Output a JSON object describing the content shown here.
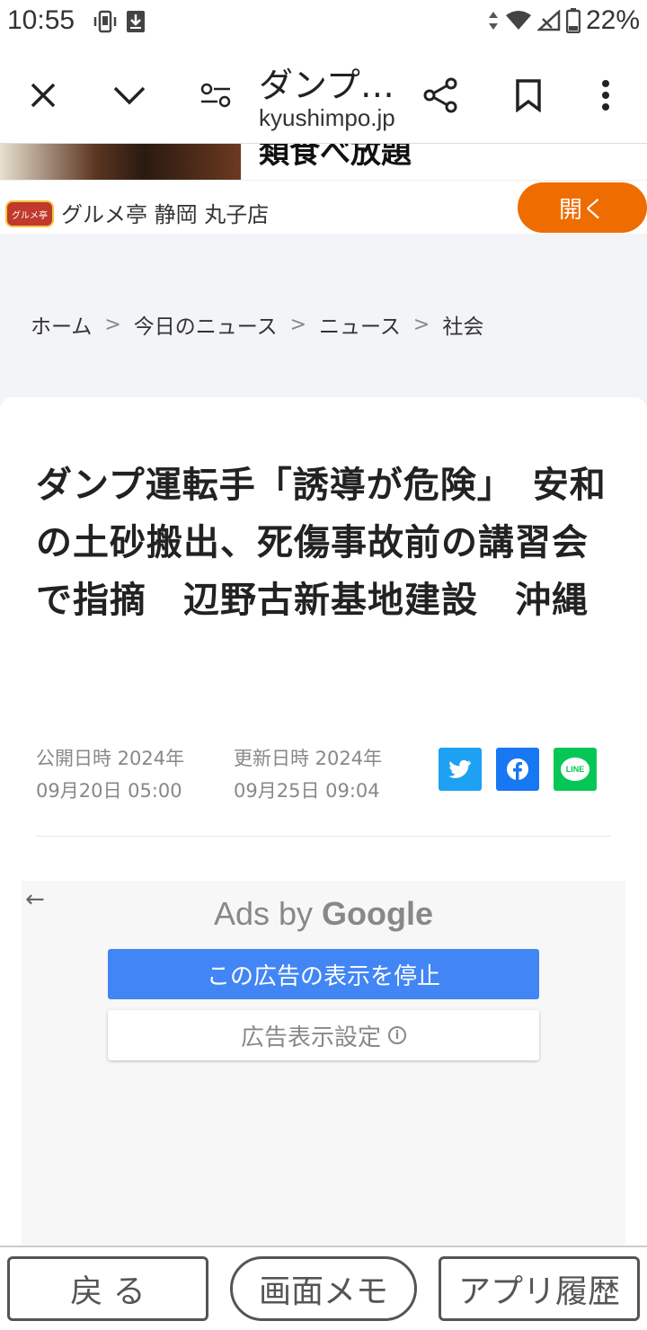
{
  "status_bar": {
    "time": "10:55",
    "battery": "22%"
  },
  "toolbar": {
    "title": "ダンプ…",
    "domain": "kyushimpo.jp"
  },
  "ad_banner": {
    "headline": "類食べ放題",
    "store_name": "グルメ亭 静岡 丸子店",
    "logo_text": "グルメ亭",
    "open_label": "開く"
  },
  "breadcrumb": [
    "ホーム",
    "今日のニュース",
    "ニュース",
    "社会"
  ],
  "article": {
    "title": "ダンプ運転手「誘導が危険」　安和の土砂搬出、死傷事故前の講習会で指摘　辺野古新基地建設　沖縄",
    "published_label": "公開日時 2024年",
    "published_date": "09月20日 05:00",
    "updated_label": "更新日時 2024年",
    "updated_date": "09月25日 09:04",
    "share_line_label": "LINE"
  },
  "ads": {
    "ads_by": "Ads by",
    "google": "Google",
    "stop_label": "この広告の表示を停止",
    "settings_label": "広告表示設定"
  },
  "bottom_bar": {
    "back": "戻 る",
    "memo": "画面メモ",
    "history": "アプリ履歴"
  },
  "colors": {
    "accent_orange": "#ef6c00",
    "twitter": "#1da1f2",
    "facebook": "#1877f2",
    "line": "#06c755",
    "ads_blue": "#4285f4"
  }
}
